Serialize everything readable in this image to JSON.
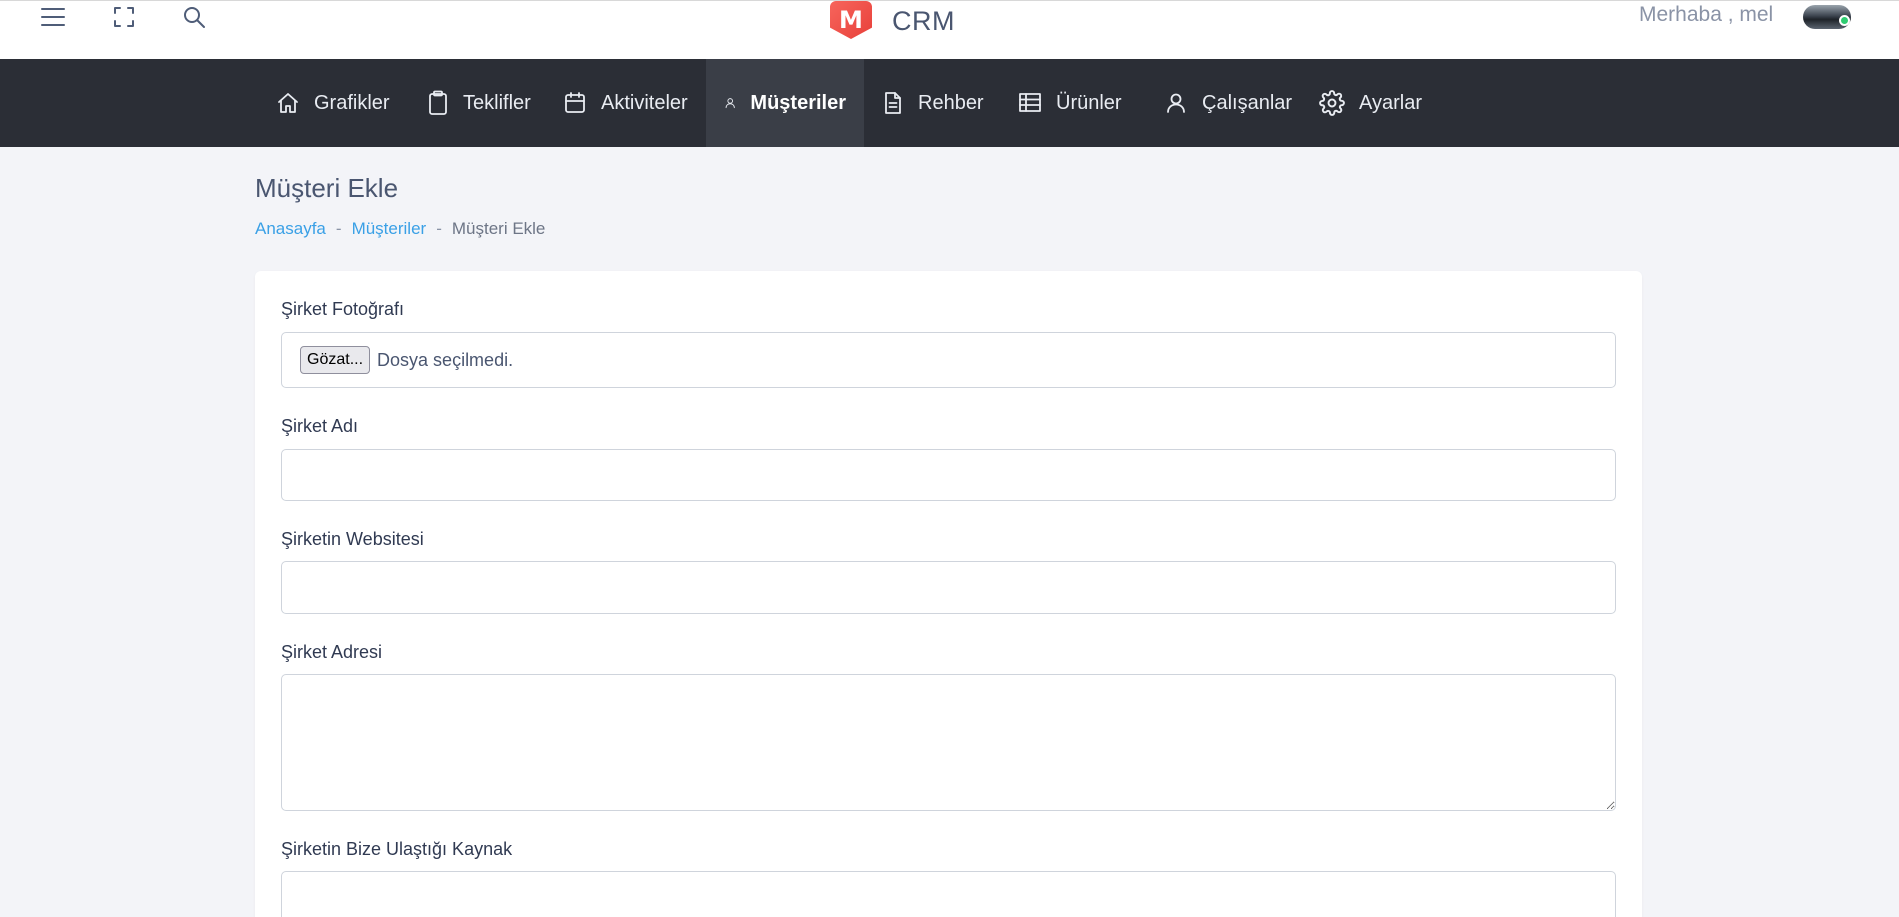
{
  "topbar": {
    "icons": [
      "menu-icon",
      "fullscreen-icon",
      "search-icon"
    ],
    "brand_letter": "M",
    "brand_name": "CRM",
    "greeting": "Merhaba , mel",
    "colors": {
      "brand": "#e8403a",
      "status_online": "#2ecc71"
    }
  },
  "nav": {
    "active": "Müşteriler",
    "items": [
      {
        "label": "Grafikler",
        "icon": "home-icon"
      },
      {
        "label": "Teklifler",
        "icon": "clipboard-icon"
      },
      {
        "label": "Aktiviteler",
        "icon": "calendar-icon"
      },
      {
        "label": "Müşteriler",
        "icon": "user-icon"
      },
      {
        "label": "Rehber",
        "icon": "document-icon"
      },
      {
        "label": "Ürünler",
        "icon": "table-icon"
      },
      {
        "label": "Çalışanlar",
        "icon": "user-icon"
      },
      {
        "label": "Ayarlar",
        "icon": "gear-icon"
      }
    ],
    "colors": {
      "background": "#2b2e36",
      "active": "#3a3e47"
    }
  },
  "page": {
    "title": "Müşteri Ekle",
    "breadcrumb": {
      "home": "Anasayfa",
      "sep": "-",
      "parent": "Müşteriler",
      "current": "Müşteri Ekle"
    }
  },
  "form": {
    "photo_label": "Şirket Fotoğrafı",
    "photo_button": "Gözat...",
    "photo_status": "Dosya seçilmedi.",
    "name_label": "Şirket Adı",
    "name_value": "",
    "website_label": "Şirketin Websitesi",
    "website_value": "",
    "address_label": "Şirket Adresi",
    "address_value": "",
    "source_label": "Şirketin Bize Ulaştığı Kaynak",
    "source_value": ""
  }
}
